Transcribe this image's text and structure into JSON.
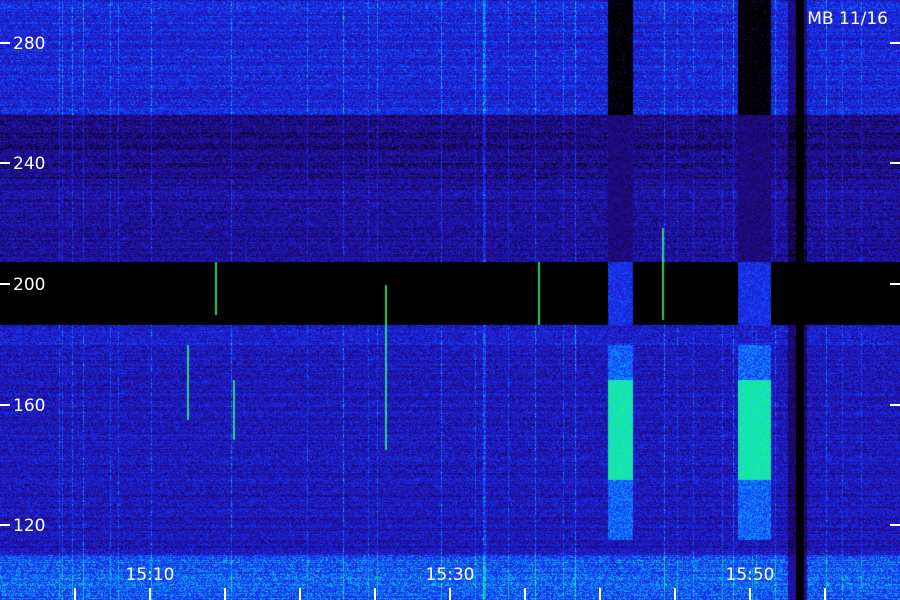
{
  "chart_data": {
    "type": "heatmap",
    "title": "MB 11/16",
    "y_ticks": [
      "280",
      "240",
      "200",
      "160",
      "120"
    ],
    "x_ticks": [
      "15:10",
      "15:30",
      "15:50"
    ],
    "colors": {
      "background": "#000000",
      "low": "#1a0a66",
      "mid": "#2b3bff",
      "high": "#18e0ff",
      "peak": "#20ff60",
      "axis": "#ffffff"
    }
  }
}
